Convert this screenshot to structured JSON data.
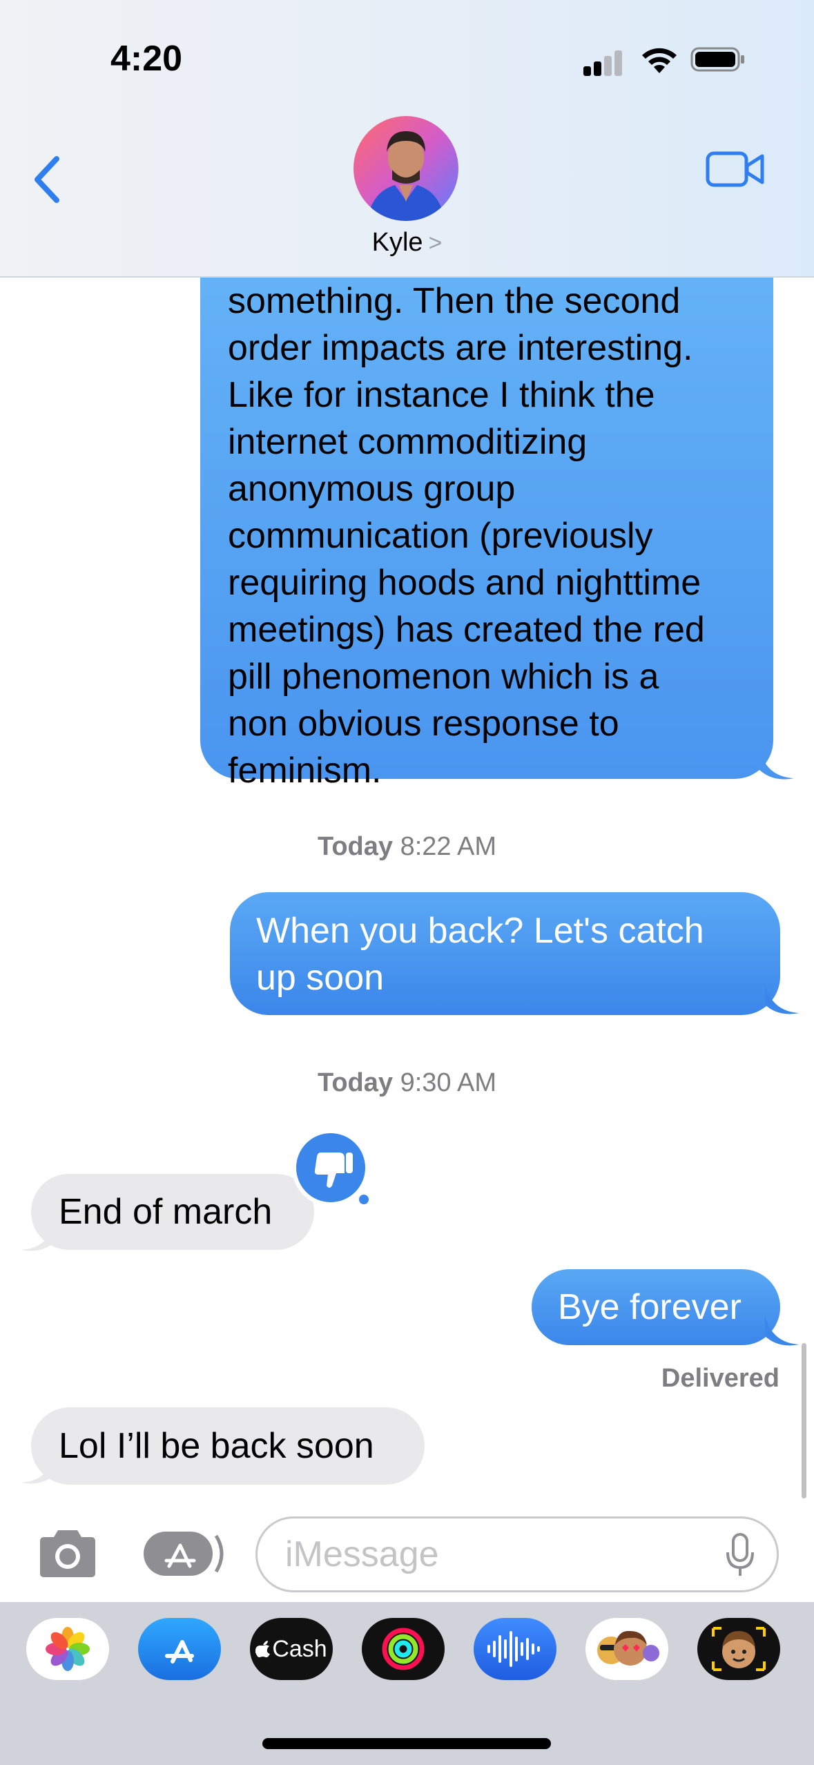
{
  "status_bar": {
    "time": "4:20"
  },
  "header": {
    "contact_name": "Kyle",
    "name_chevron": ">"
  },
  "messages": [
    {
      "type": "outgoing",
      "text": "something. Then the second\norder impacts are interesting.\nLike for instance I think the\ninternet commoditizing\nanonymous group\ncommunication (previously\nrequiring hoods and nighttime\nmeetings) has created the red\npill phenomenon which is a\nnon obvious response to\nfeminism."
    },
    {
      "type": "timestamp",
      "day": "Today",
      "time": "8:22 AM"
    },
    {
      "type": "outgoing",
      "text": "When you back? Let's catch\nup soon"
    },
    {
      "type": "timestamp",
      "day": "Today",
      "time": "9:30 AM"
    },
    {
      "type": "incoming",
      "text": "End of march",
      "reaction": "thumbs-down"
    },
    {
      "type": "outgoing",
      "text": "Bye forever",
      "status": "Delivered"
    },
    {
      "type": "incoming",
      "text": "Lol I’ll be back soon"
    }
  ],
  "compose": {
    "placeholder": "iMessage"
  },
  "app_drawer": {
    "items": [
      {
        "name": "photos-app",
        "label": ""
      },
      {
        "name": "app-store-app",
        "label": ""
      },
      {
        "name": "apple-cash-app",
        "label": "Cash"
      },
      {
        "name": "activity-app",
        "label": ""
      },
      {
        "name": "audio-message-app",
        "label": ""
      },
      {
        "name": "animoji-stickers-app",
        "label": ""
      },
      {
        "name": "memoji-app",
        "label": ""
      }
    ]
  },
  "colors": {
    "accent": "#3b86ea",
    "bubble_in": "#e9e9eb",
    "drawer_bg": "#d0d3da"
  }
}
